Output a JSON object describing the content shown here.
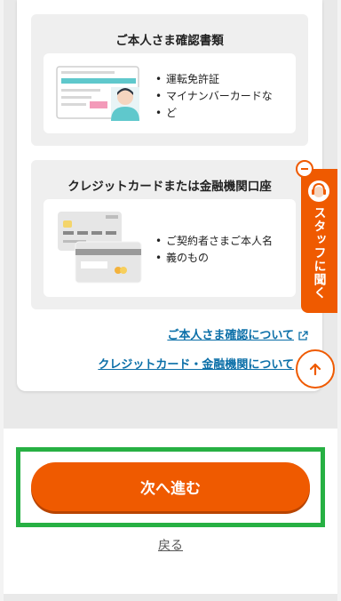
{
  "identity_docs": {
    "title": "ご本人さま確認書類",
    "bullets": [
      "運転免許証",
      "マイナンバーカードな",
      "ど"
    ]
  },
  "bank_docs": {
    "title": "クレジットカードまたは金融機関口座",
    "bullets": [
      "ご契約者さまご本人名",
      "義のもの"
    ]
  },
  "links": {
    "identity": "ご本人さま確認について",
    "bank": "クレジットカード・金融機関について"
  },
  "staff_tab": {
    "label": "スタッフに聞く"
  },
  "buttons": {
    "next": "次へ進む",
    "back": "戻る"
  },
  "colors": {
    "accent": "#ef5a00",
    "link": "#0b6fa8",
    "highlight": "#27b043"
  }
}
